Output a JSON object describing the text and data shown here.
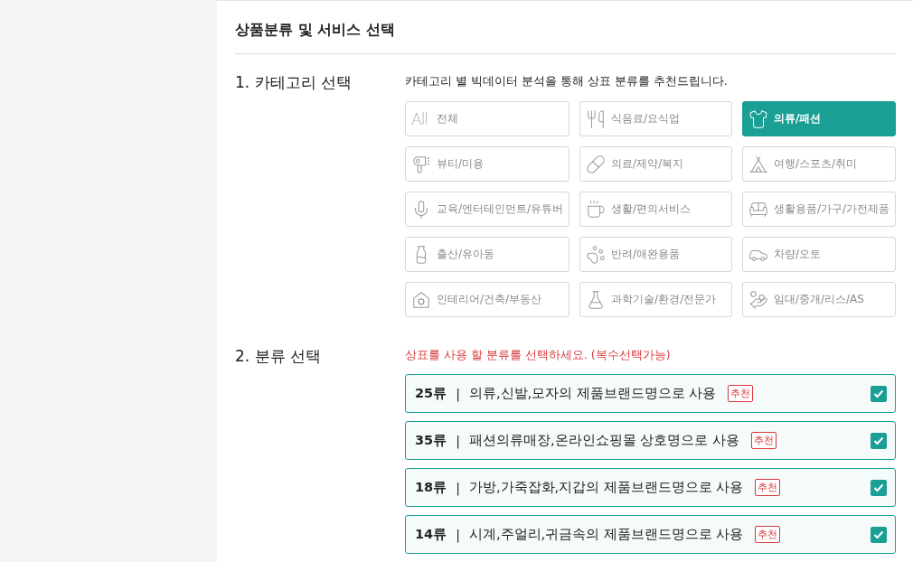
{
  "heading": "상품분류 및 서비스 선택",
  "category_section": {
    "title": "1. 카테고리 선택",
    "description": "카테고리 별 빅데이터 분석을 통해 상표 분류를 추천드립니다.",
    "items": [
      {
        "icon_text": "All",
        "label": "전체",
        "selected": false
      },
      {
        "label": "식음료/요식업",
        "selected": false
      },
      {
        "label": "의류/패션",
        "selected": true
      },
      {
        "label": "뷰티/미용",
        "selected": false
      },
      {
        "label": "의료/제약/복지",
        "selected": false
      },
      {
        "label": "여행/스포츠/취미",
        "selected": false
      },
      {
        "label": "교육/엔터테인먼트/유튜버",
        "selected": false
      },
      {
        "label": "생활/편의서비스",
        "selected": false
      },
      {
        "label": "생활용품/가구/가전제품",
        "selected": false
      },
      {
        "label": "출산/유아동",
        "selected": false
      },
      {
        "label": "반려/애완용품",
        "selected": false
      },
      {
        "label": "차량/오토",
        "selected": false
      },
      {
        "label": "인테리어/건축/부동산",
        "selected": false
      },
      {
        "label": "과학기술/환경/전문가",
        "selected": false
      },
      {
        "label": "임대/중개/리스/AS",
        "selected": false
      }
    ]
  },
  "class_section": {
    "title": "2. 분류 선택",
    "notice": "상표를 사용 할 분류를 선택하세요. (복수선택가능)",
    "classes": [
      {
        "number": "25류",
        "separator": "|",
        "description": "의류,신발,모자의 제품브랜드명으로 사용",
        "badge": "추천",
        "checked": true
      },
      {
        "number": "35류",
        "separator": "|",
        "description": "패션의류매장,온라인쇼핑몰 상호명으로 사용",
        "badge": "추천",
        "checked": true
      },
      {
        "number": "18류",
        "separator": "|",
        "description": "가방,가죽잡화,지갑의 제품브랜드명으로 사용",
        "badge": "추천",
        "checked": true
      },
      {
        "number": "14류",
        "separator": "|",
        "description": "시계,주얼리,귀금속의 제품브랜드명으로 사용",
        "badge": "추천",
        "checked": true
      }
    ]
  }
}
